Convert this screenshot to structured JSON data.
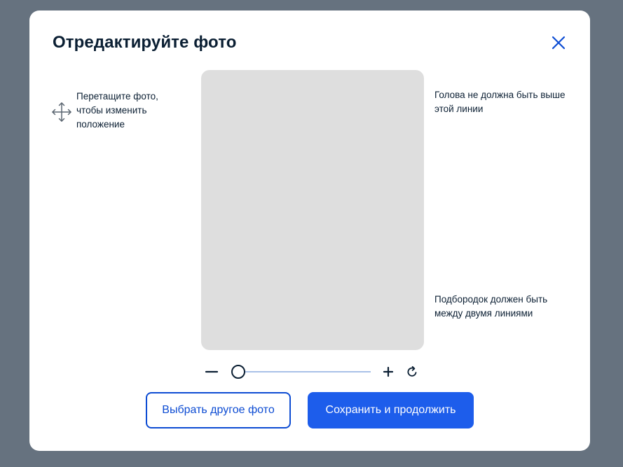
{
  "modal": {
    "title": "Отредактируйте фото"
  },
  "hints": {
    "drag": "Перетащите фото, чтобы изменить положение",
    "head": "Голова не должна быть выше этой линии",
    "chin": "Подбородок должен быть между двумя линиями"
  },
  "zoom": {
    "level": 0
  },
  "buttons": {
    "choose_other": "Выбрать другое фото",
    "save_continue": "Сохранить и продолжить"
  },
  "icons": {
    "close": "close-icon",
    "move": "move-icon",
    "minus": "zoom-out-icon",
    "plus": "zoom-in-icon",
    "rotate": "rotate-icon"
  },
  "colors": {
    "overlay": "#66727f",
    "primary": "#1d5deb",
    "primary_border": "#0d4cd3",
    "text": "#0b1f33",
    "photo_placeholder": "#dedede",
    "slider_track": "#a9c1e8"
  }
}
